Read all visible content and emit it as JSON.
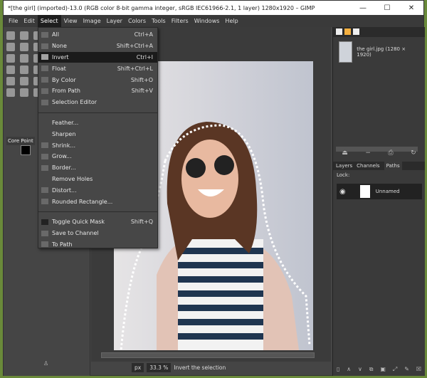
{
  "window": {
    "title": "*[the girl] (imported)-13.0 (RGB color 8-bit gamma integer, sRGB IEC61966-2.1, 1 layer) 1280x1920 – GIMP",
    "minimize": "—",
    "maximize": "☐",
    "close": "✕"
  },
  "menubar": [
    "File",
    "Edit",
    "Select",
    "View",
    "Image",
    "Layer",
    "Colors",
    "Tools",
    "Filters",
    "Windows",
    "Help"
  ],
  "toolbox": {
    "tool_options": "Core Point"
  },
  "select_menu": {
    "group1": [
      {
        "label": "All",
        "shortcut": "Ctrl+A"
      },
      {
        "label": "None",
        "shortcut": "Shift+Ctrl+A"
      },
      {
        "label": "Invert",
        "shortcut": "Ctrl+I"
      },
      {
        "label": "Float",
        "shortcut": "Shift+Ctrl+L"
      },
      {
        "label": "By Color",
        "shortcut": "Shift+O"
      },
      {
        "label": "From Path",
        "shortcut": "Shift+V"
      },
      {
        "label": "Selection Editor",
        "shortcut": ""
      }
    ],
    "group2": [
      {
        "label": "Feather..."
      },
      {
        "label": "Sharpen"
      },
      {
        "label": "Shrink..."
      },
      {
        "label": "Grow..."
      },
      {
        "label": "Border..."
      },
      {
        "label": "Remove Holes"
      },
      {
        "label": "Distort..."
      },
      {
        "label": "Rounded Rectangle..."
      }
    ],
    "group3": [
      {
        "label": "Toggle Quick Mask",
        "shortcut": "Shift+Q"
      },
      {
        "label": "Save to Channel",
        "shortcut": ""
      },
      {
        "label": "To Path",
        "shortcut": ""
      }
    ]
  },
  "images_panel": {
    "item": "the girl.jpg (1280 × 1920)"
  },
  "layers_panel": {
    "tabs": [
      "Layers",
      "Channels",
      "Paths"
    ],
    "lock_label": "Lock:",
    "path_name": "Unnamed"
  },
  "statusbar": {
    "unit": "px",
    "zoom": "33.3 %",
    "message": "Invert the selection"
  }
}
